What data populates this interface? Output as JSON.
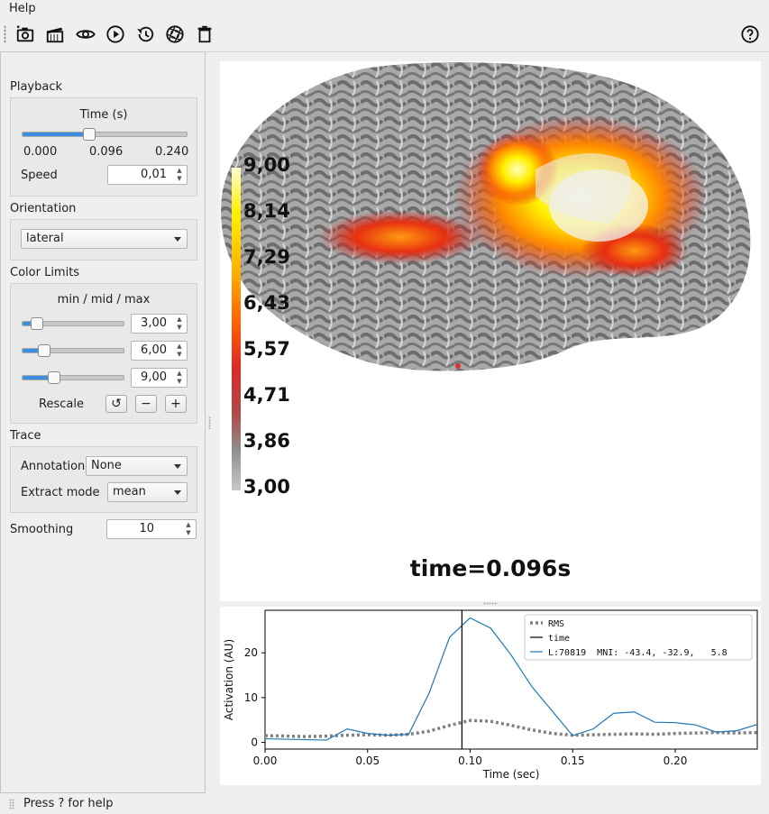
{
  "menu": {
    "help": "Help"
  },
  "toolbar": {
    "icons": [
      "screenshot-icon",
      "movie-icon",
      "visibility-icon",
      "play-icon",
      "restore-icon",
      "shutter-icon",
      "delete-icon",
      "help-icon"
    ]
  },
  "playback": {
    "title": "Playback",
    "time_label": "Time (s)",
    "time_fraction": 0.4,
    "ticks": [
      "0.000",
      "0.096",
      "0.240"
    ],
    "speed_label": "Speed",
    "speed_value": "0,01"
  },
  "orientation": {
    "title": "Orientation",
    "value": "lateral"
  },
  "color_limits": {
    "title": "Color Limits",
    "subtitle": "min / mid / max",
    "min": "3,00",
    "mid": "6,00",
    "max": "9,00",
    "rescale_label": "Rescale",
    "reset_symbol": "↺",
    "minus_symbol": "−",
    "plus_symbol": "+"
  },
  "trace": {
    "title": "Trace",
    "annotation_label": "Annotation",
    "annotation_value": "None",
    "extract_label": "Extract mode",
    "extract_value": "mean"
  },
  "smoothing": {
    "label": "Smoothing",
    "value": "10"
  },
  "viewer": {
    "colorbar_labels": [
      "9,00",
      "8,14",
      "7,29",
      "6,43",
      "5,57",
      "4,71",
      "3,86",
      "3,00"
    ],
    "time_text": "time=0.096s"
  },
  "status": {
    "text": "Press ? for help"
  },
  "chart_data": {
    "type": "line",
    "xlabel": "Time (sec)",
    "ylabel": "Activation (AU)",
    "xlim": [
      0,
      0.24
    ],
    "ylim": [
      -1.5,
      29.5
    ],
    "xticks": [
      "0.00",
      "0.05",
      "0.10",
      "0.15",
      "0.20"
    ],
    "yticks": [
      "0",
      "10",
      "20"
    ],
    "time_marker": 0.096,
    "legend_position": "top-right",
    "series": [
      {
        "name": "RMS",
        "style": "dotted",
        "color": "#808080",
        "x": [
          0,
          0.01,
          0.02,
          0.03,
          0.04,
          0.05,
          0.06,
          0.07,
          0.08,
          0.09,
          0.1,
          0.11,
          0.12,
          0.13,
          0.14,
          0.15,
          0.16,
          0.17,
          0.18,
          0.19,
          0.2,
          0.21,
          0.22,
          0.23,
          0.24
        ],
        "y": [
          1.5,
          1.4,
          1.3,
          1.4,
          1.6,
          1.7,
          1.6,
          1.8,
          2.5,
          3.8,
          4.9,
          4.7,
          3.8,
          2.8,
          2.0,
          1.6,
          1.7,
          1.8,
          1.9,
          1.8,
          2.0,
          2.1,
          2.2,
          2.1,
          2.2
        ]
      },
      {
        "name": "time",
        "style": "vline",
        "color": "#000000"
      },
      {
        "name": "L:70819  MNI: -43.4, -32.9,   5.8",
        "style": "solid",
        "color": "#1f77b4",
        "x": [
          0,
          0.01,
          0.02,
          0.03,
          0.04,
          0.05,
          0.06,
          0.07,
          0.08,
          0.09,
          0.1,
          0.11,
          0.12,
          0.13,
          0.14,
          0.15,
          0.16,
          0.17,
          0.18,
          0.19,
          0.2,
          0.21,
          0.22,
          0.23,
          0.24
        ],
        "y": [
          0.8,
          0.7,
          0.6,
          0.5,
          3.0,
          2.0,
          1.6,
          1.8,
          11.0,
          23.5,
          27.8,
          25.5,
          19.5,
          12.5,
          7.0,
          1.5,
          3.0,
          6.5,
          6.8,
          4.5,
          4.4,
          3.9,
          2.3,
          2.6,
          4.0
        ]
      }
    ]
  }
}
